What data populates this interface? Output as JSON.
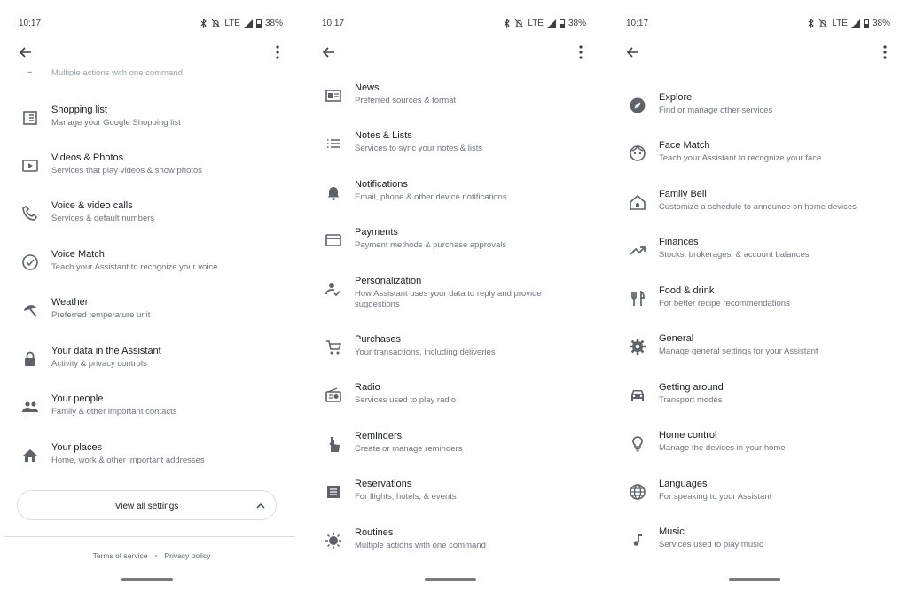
{
  "status": {
    "time": "10:17",
    "network": "LTE",
    "battery": "38%"
  },
  "screen1": {
    "truncated_sub": "Multiple actions with one command",
    "items": [
      {
        "title": "Shopping list",
        "sub": "Manage your Google Shopping list",
        "icon": "shopping-list-icon"
      },
      {
        "title": "Videos & Photos",
        "sub": "Services that play videos & show photos",
        "icon": "video-icon"
      },
      {
        "title": "Voice & video calls",
        "sub": "Services & default numbers",
        "icon": "phone-icon"
      },
      {
        "title": "Voice Match",
        "sub": "Teach your Assistant to recognize your voice",
        "icon": "voice-match-icon"
      },
      {
        "title": "Weather",
        "sub": "Preferred temperature unit",
        "icon": "weather-icon"
      },
      {
        "title": "Your data in the Assistant",
        "sub": "Activity & privacy controls",
        "icon": "lock-icon"
      },
      {
        "title": "Your people",
        "sub": "Family & other important contacts",
        "icon": "people-icon"
      },
      {
        "title": "Your places",
        "sub": "Home, work & other important addresses",
        "icon": "home-icon"
      }
    ],
    "view_all": "View all settings",
    "footer": {
      "terms": "Terms of service",
      "separator": "•",
      "privacy": "Privacy policy"
    }
  },
  "screen2": {
    "items": [
      {
        "title": "News",
        "sub": "Preferred sources & format",
        "icon": "news-icon"
      },
      {
        "title": "Notes & Lists",
        "sub": "Services to sync your notes & lists",
        "icon": "list-icon"
      },
      {
        "title": "Notifications",
        "sub": "Email, phone & other device notifications",
        "icon": "bell-icon"
      },
      {
        "title": "Payments",
        "sub": "Payment methods & purchase approvals",
        "icon": "card-icon"
      },
      {
        "title": "Personalization",
        "sub": "How Assistant uses your data to reply and provide suggestions",
        "icon": "personalization-icon"
      },
      {
        "title": "Purchases",
        "sub": "Your transactions, including deliveries",
        "icon": "cart-icon"
      },
      {
        "title": "Radio",
        "sub": "Services used to play radio",
        "icon": "radio-icon"
      },
      {
        "title": "Reminders",
        "sub": "Create or manage reminders",
        "icon": "reminder-icon"
      },
      {
        "title": "Reservations",
        "sub": "For flights, hotels, & events",
        "icon": "reservation-icon"
      },
      {
        "title": "Routines",
        "sub": "Multiple actions with one command",
        "icon": "routines-icon"
      }
    ]
  },
  "screen3": {
    "items": [
      {
        "title": "Explore",
        "sub": "Find or manage other services",
        "icon": "compass-icon"
      },
      {
        "title": "Face Match",
        "sub": "Teach your Assistant to recognize your face",
        "icon": "face-icon"
      },
      {
        "title": "Family Bell",
        "sub": "Customize a schedule to announce on home devices",
        "icon": "family-bell-icon"
      },
      {
        "title": "Finances",
        "sub": "Stocks, brokerages, & account balances",
        "icon": "trending-icon"
      },
      {
        "title": "Food & drink",
        "sub": "For better recipe recommendations",
        "icon": "restaurant-icon"
      },
      {
        "title": "General",
        "sub": "Manage general settings for your Assistant",
        "icon": "gear-icon"
      },
      {
        "title": "Getting around",
        "sub": "Transport modes",
        "icon": "car-icon"
      },
      {
        "title": "Home control",
        "sub": "Manage the devices in your home",
        "icon": "lightbulb-icon"
      },
      {
        "title": "Languages",
        "sub": "For speaking to your Assistant",
        "icon": "globe-icon"
      },
      {
        "title": "Music",
        "sub": "Services used to play music",
        "icon": "music-note-icon"
      }
    ]
  }
}
